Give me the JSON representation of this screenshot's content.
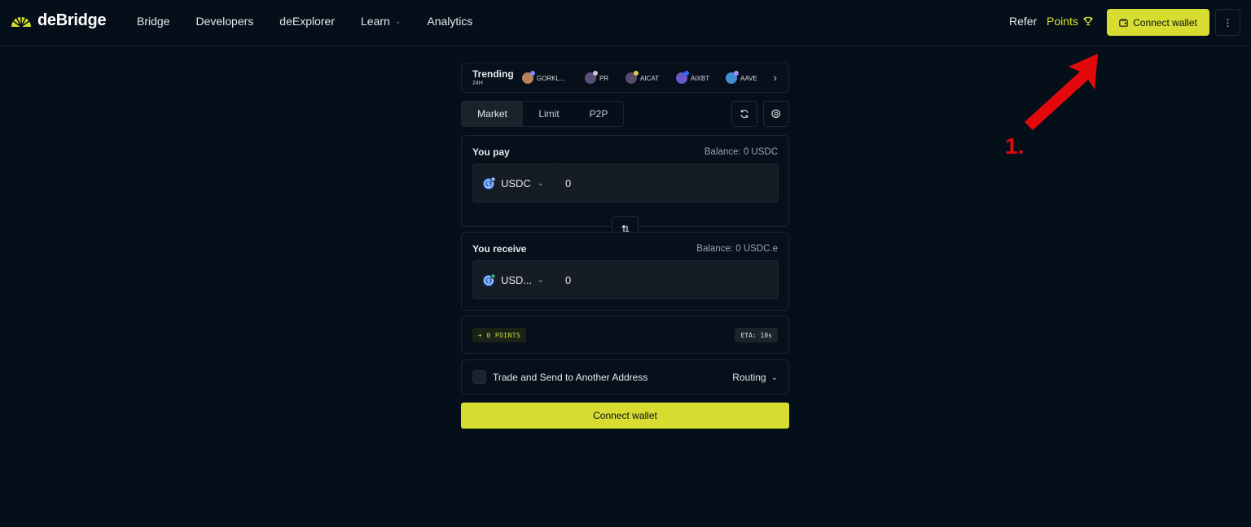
{
  "header": {
    "logo_text": "deBridge",
    "nav": [
      {
        "label": "Bridge"
      },
      {
        "label": "Developers"
      },
      {
        "label": "deExplorer"
      },
      {
        "label": "Learn",
        "dropdown": true
      },
      {
        "label": "Analytics"
      }
    ],
    "refer_label": "Refer",
    "points_label": "Points",
    "connect_wallet_label": "Connect wallet",
    "more_icon": "vertical-dots-icon"
  },
  "trending": {
    "title": "Trending",
    "period": "24H",
    "tokens": [
      {
        "symbol": "GORKL...",
        "color": "#b6825a",
        "badge": "#7c8cff"
      },
      {
        "symbol": "PR",
        "color": "#5b4f7a",
        "badge": "#c5c9d6"
      },
      {
        "symbol": "AICAT",
        "color": "#574a6e",
        "badge": "#e5c84a"
      },
      {
        "symbol": "AIXBT",
        "color": "#6a59c8",
        "badge": "#2d6cff"
      },
      {
        "symbol": "AAVE",
        "color": "#3f8fd0",
        "badge": "#b08cf0"
      }
    ]
  },
  "tabs": [
    {
      "label": "Market",
      "active": true
    },
    {
      "label": "Limit",
      "active": false
    },
    {
      "label": "P2P",
      "active": false
    }
  ],
  "pay": {
    "title": "You pay",
    "balance": "Balance: 0  USDC",
    "token": "USDC",
    "amount": "0"
  },
  "receive": {
    "title": "You receive",
    "balance": "Balance: 0 USDC.e",
    "token": "USD...",
    "amount": "0"
  },
  "points_badge": "+ 0 POINTS",
  "eta_badge": "ETA: 10s",
  "send_to_another": "Trade and Send to Another Address",
  "routing_label": "Routing",
  "connect_wallet_main": "Connect wallet",
  "annotation": {
    "text": "1.",
    "color": "#e3080c"
  },
  "colors": {
    "accent": "#d7dd30",
    "background": "#050f1a"
  }
}
